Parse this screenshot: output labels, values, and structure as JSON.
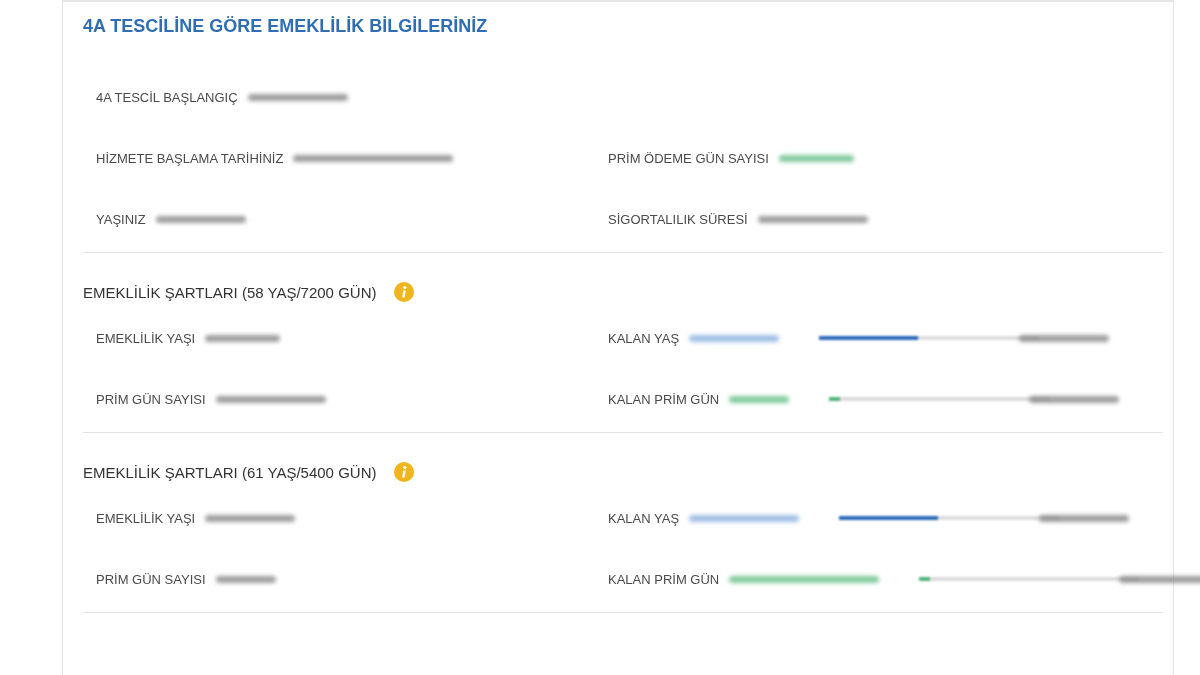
{
  "title": "4A TESCİLİNE GÖRE EMEKLİLİK BİLGİLERİNİZ",
  "general": {
    "rows": [
      {
        "left": {
          "label": "4A TESCİL BAŞLANGIÇ",
          "kind": "plain"
        }
      },
      {
        "left": {
          "label": "HİZMETE BAŞLAMA TARİHİNİZ",
          "kind": "plain"
        },
        "right": {
          "label": "PRİM ÖDEME GÜN SAYISI",
          "kind": "days"
        }
      },
      {
        "left": {
          "label": "YAŞINIZ",
          "kind": "plain"
        },
        "right": {
          "label": "SİGORTALILIK SÜRESİ",
          "kind": "plain"
        }
      }
    ]
  },
  "sections": [
    {
      "heading": "EMEKLİLİK ŞARTLARI (58 YAŞ/7200 GÜN)",
      "rows": [
        {
          "left": {
            "label": "EMEKLİLİK YAŞI",
            "kind": "plain"
          },
          "right": {
            "label": "KALAN YAŞ",
            "kind": "age",
            "progress": {
              "level": 0.45
            }
          }
        },
        {
          "left": {
            "label": "PRİM GÜN SAYISI",
            "kind": "plain"
          },
          "right": {
            "label": "KALAN PRİM GÜN",
            "kind": "days",
            "progress": {
              "level": 0.05
            }
          }
        }
      ]
    },
    {
      "heading": "EMEKLİLİK ŞARTLARI (61 YAŞ/5400 GÜN)",
      "rows": [
        {
          "left": {
            "label": "EMEKLİLİK YAŞI",
            "kind": "plain"
          },
          "right": {
            "label": "KALAN YAŞ",
            "kind": "age",
            "progress": {
              "level": 0.45
            }
          }
        },
        {
          "left": {
            "label": "PRİM GÜN SAYISI",
            "kind": "plain"
          },
          "right": {
            "label": "KALAN PRİM GÜN",
            "kind": "days",
            "progress": {
              "level": 0.05
            }
          }
        }
      ]
    }
  ]
}
